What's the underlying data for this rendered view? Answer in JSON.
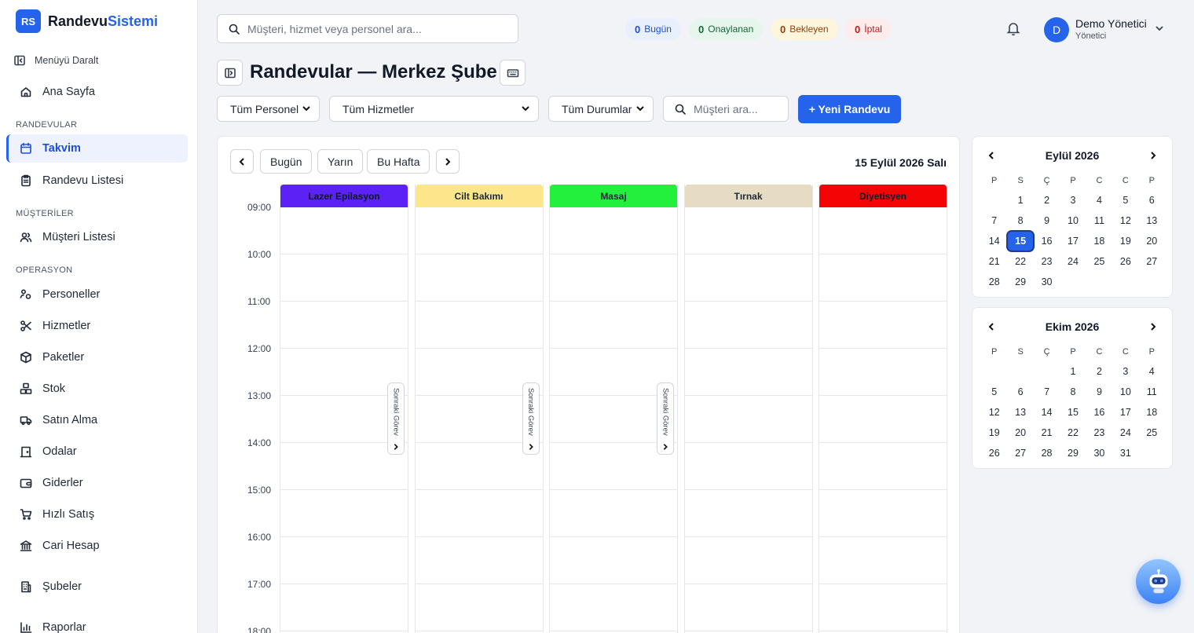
{
  "brand": {
    "badge": "RS",
    "name_main": "Randevu",
    "name_accent": "Sistemi"
  },
  "sidebar": {
    "collapse_label": "Menüyü Daralt",
    "home": "Ana Sayfa",
    "sections": {
      "appointments": "RANDEVULAR",
      "customers": "MÜŞTERİLER",
      "operations": "OPERASYON"
    },
    "items": {
      "calendar": "Takvim",
      "appointment_list": "Randevu Listesi",
      "customer_list": "Müşteri Listesi",
      "staff": "Personeller",
      "services": "Hizmetler",
      "packages": "Paketler",
      "stock": "Stok",
      "purchasing": "Satın Alma",
      "rooms": "Odalar",
      "expenses": "Giderler",
      "quick_sale": "Hızlı Satış",
      "current_account": "Cari Hesap",
      "branches": "Şubeler",
      "reports": "Raporlar"
    }
  },
  "topbar": {
    "search_placeholder": "Müşteri, hizmet veya personel ara...",
    "stats": [
      {
        "count": "0",
        "label": "Bugün"
      },
      {
        "count": "0",
        "label": "Onaylanan"
      },
      {
        "count": "0",
        "label": "Bekleyen"
      },
      {
        "count": "0",
        "label": "İptal"
      }
    ],
    "user": {
      "initial": "D",
      "name": "Demo Yönetici",
      "role": "Yönetici"
    }
  },
  "page": {
    "title": "Randevular — Merkez Şube"
  },
  "filters": {
    "staff": "Tüm Personel",
    "services": "Tüm Hizmetler",
    "statuses": "Tüm Durumlar",
    "customer_search_placeholder": "Müşteri ara...",
    "new_button": "+ Yeni Randevu"
  },
  "calendar": {
    "buttons": {
      "today": "Bugün",
      "tomorrow": "Yarın",
      "this_week": "Bu Hafta"
    },
    "current_date": "15 Eylül 2026 Salı",
    "times": [
      "09:00",
      "10:00",
      "11:00",
      "12:00",
      "13:00",
      "14:00",
      "15:00",
      "16:00",
      "17:00",
      "18:00"
    ],
    "next_task_label": "Sonraki Görev",
    "columns": [
      {
        "name": "Lazer Epilasyon",
        "color": "#5b21f5"
      },
      {
        "name": "Cilt Bakımı",
        "color": "#fde68a"
      },
      {
        "name": "Masaj",
        "color": "#22f03c"
      },
      {
        "name": "Tırnak",
        "color": "#e5dcc3"
      },
      {
        "name": "Diyetisyen",
        "color": "#f40404"
      }
    ]
  },
  "mini_calendars": {
    "weekday_headers": [
      "P",
      "S",
      "Ç",
      "P",
      "C",
      "C",
      "P"
    ],
    "september": {
      "title": "Eylül 2026",
      "selected_day": "15"
    },
    "october": {
      "title": "Ekim 2026"
    }
  }
}
